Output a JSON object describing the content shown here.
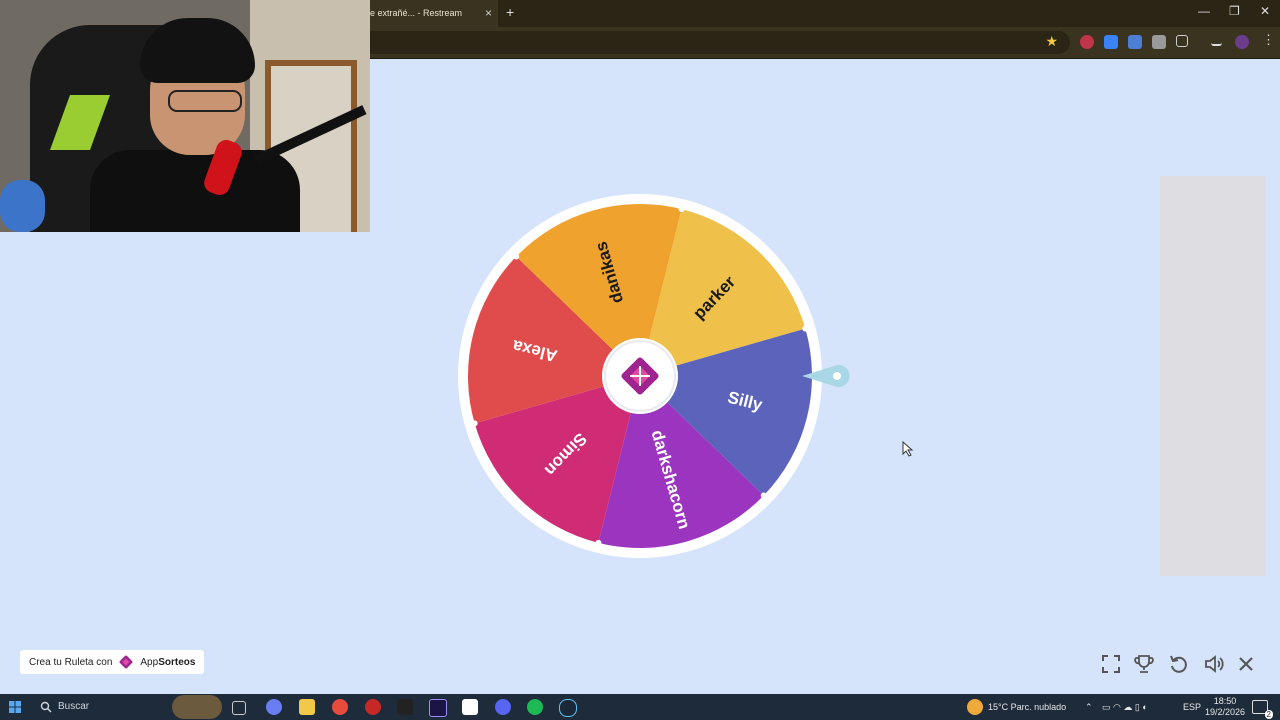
{
  "browser": {
    "tab_title": "e extrañé... - Restream",
    "tab_close": "×",
    "new_tab": "+",
    "win_min": "—",
    "win_restore": "❐",
    "win_close": "✕"
  },
  "wheel": {
    "pointer_color": "#a9d7e6",
    "segments": [
      {
        "label": "parker",
        "color": "#efc04a",
        "text_color": "#1a1a1a"
      },
      {
        "label": "Silly",
        "color": "#5c63bb",
        "text_color": "#ffffff"
      },
      {
        "label": "darkshacorn",
        "color": "#9b35c0",
        "text_color": "#ffffff"
      },
      {
        "label": "Simon",
        "color": "#d02c75",
        "text_color": "#ffffff"
      },
      {
        "label": "Alexa",
        "color": "#e04c4c",
        "text_color": "#ffffff"
      },
      {
        "label": "danikas",
        "color": "#f0a22e",
        "text_color": "#1a1a1a"
      }
    ]
  },
  "credit": {
    "prefix": "Crea tu Ruleta con",
    "brand_app": "App",
    "brand_name": "Sorteos"
  },
  "controls": [
    "fullscreen-icon",
    "trophy-icon",
    "reset-icon",
    "volume-icon",
    "close-icon"
  ],
  "taskbar": {
    "search_placeholder": "Buscar",
    "weather": "15°C  Parc. nublado",
    "language": "ESP",
    "time": "18:50",
    "date": "19/2/2026",
    "notification_count": "2"
  }
}
